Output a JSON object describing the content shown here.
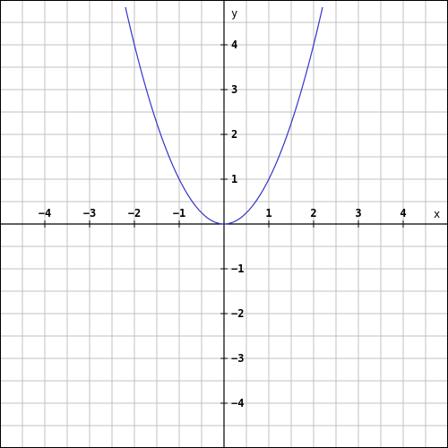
{
  "chart_data": {
    "type": "line",
    "xlabel": "x",
    "ylabel": "y",
    "xlim": [
      -5,
      5
    ],
    "ylim": [
      -5,
      5
    ],
    "grid": true,
    "grid_step": 0.5,
    "x_ticks": [
      "−4",
      "−3",
      "−2",
      "−1",
      "1",
      "2",
      "3",
      "4"
    ],
    "y_ticks": [
      "4",
      "3",
      "2",
      "1",
      "−1",
      "−2",
      "−3",
      "−4"
    ],
    "x_tick_values": [
      -4,
      -3,
      -2,
      -1,
      1,
      2,
      3,
      4
    ],
    "y_tick_values": [
      4,
      3,
      2,
      1,
      -1,
      -2,
      -3,
      -4
    ],
    "series": [
      {
        "color": "#3333cc",
        "x": [
          -2.2,
          -2,
          -1.75,
          -1.5,
          -1.25,
          -1,
          -0.75,
          -0.5,
          -0.25,
          0,
          0.25,
          0.5,
          0.75,
          1,
          1.25,
          1.5,
          1.75,
          2,
          2.2
        ],
        "y": [
          4.84,
          4,
          3.0625,
          2.25,
          1.5625,
          1,
          0.5625,
          0.25,
          0.0625,
          0,
          0.0625,
          0.25,
          0.5625,
          1,
          1.5625,
          2.25,
          3.0625,
          4,
          4.84
        ]
      }
    ]
  },
  "colors": {
    "grid": "#c0c0c0",
    "axis": "#000000",
    "background": "#ffffff"
  }
}
